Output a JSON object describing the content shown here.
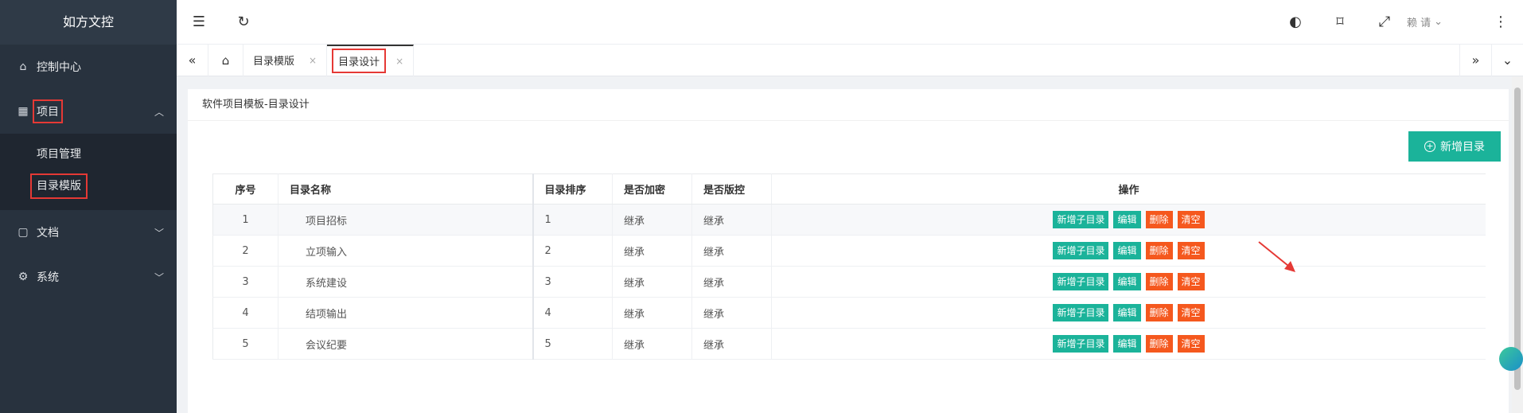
{
  "brand": "如方文控",
  "sidebar": {
    "items": [
      {
        "label": "控制中心",
        "icon": "home-icon"
      },
      {
        "label": "项目",
        "icon": "grid-icon",
        "expanded": true,
        "children": [
          {
            "label": "项目管理"
          },
          {
            "label": "目录模版"
          }
        ]
      },
      {
        "label": "文档",
        "icon": "document-icon"
      },
      {
        "label": "系统",
        "icon": "gear-icon"
      }
    ]
  },
  "header": {
    "user_name": "赖 请"
  },
  "tabs": [
    {
      "label": "目录模版",
      "close": "×"
    },
    {
      "label": "目录设计",
      "close": "×",
      "active": true
    }
  ],
  "page": {
    "breadcrumb": "软件项目模板-目录设计",
    "add_button_label": "新增目录"
  },
  "table": {
    "columns": [
      "序号",
      "目录名称",
      "目录排序",
      "是否加密",
      "是否版控",
      "操作"
    ],
    "rows": [
      {
        "no": "1",
        "name": "项目招标",
        "sort": "1",
        "encrypt": "继承",
        "version": "继承"
      },
      {
        "no": "2",
        "name": "立项输入",
        "sort": "2",
        "encrypt": "继承",
        "version": "继承"
      },
      {
        "no": "3",
        "name": "系统建设",
        "sort": "3",
        "encrypt": "继承",
        "version": "继承"
      },
      {
        "no": "4",
        "name": "结项输出",
        "sort": "4",
        "encrypt": "继承",
        "version": "继承"
      },
      {
        "no": "5",
        "name": "会议纪要",
        "sort": "5",
        "encrypt": "继承",
        "version": "继承"
      }
    ],
    "actions": [
      "新增子目录",
      "编辑",
      "删除",
      "清空"
    ]
  },
  "colors": {
    "sidebar_bg": "#28323e",
    "accent_green": "#1bb39a",
    "accent_orange": "#f5581e",
    "annotation_red": "#e53935"
  }
}
